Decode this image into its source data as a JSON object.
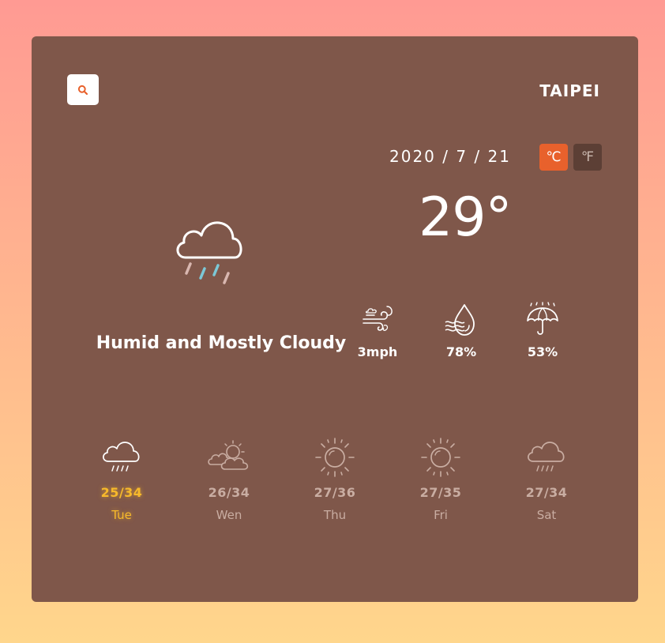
{
  "header": {
    "search_icon": "search-icon",
    "city": "TAIPEI"
  },
  "current": {
    "date": "2020 / 7 / 21",
    "temperature": "29°",
    "condition": "Humid and Mostly Cloudy",
    "icon": "cloud-rain-icon"
  },
  "units": {
    "celsius": "℃",
    "fahrenheit": "℉",
    "selected": "celsius"
  },
  "stats": [
    {
      "icon": "wind-icon",
      "value": "3mph"
    },
    {
      "icon": "humidity-icon",
      "value": "78%"
    },
    {
      "icon": "umbrella-icon",
      "value": "53%"
    }
  ],
  "forecast": [
    {
      "day": "Tue",
      "range": "25/34",
      "icon": "cloud-rain-icon",
      "active": true
    },
    {
      "day": "Wen",
      "range": "26/34",
      "icon": "partly-cloudy-icon",
      "active": false
    },
    {
      "day": "Thu",
      "range": "27/36",
      "icon": "sun-icon",
      "active": false
    },
    {
      "day": "Fri",
      "range": "27/35",
      "icon": "sun-icon",
      "active": false
    },
    {
      "day": "Sat",
      "range": "27/34",
      "icon": "cloud-rain-icon",
      "active": false
    }
  ],
  "colors": {
    "card": "#7f574a",
    "accent": "#e8612c",
    "active_day": "#f7b92b",
    "inactive_day": "#c9ada2",
    "rain_blue": "#7cc8d6",
    "rain_pink": "#d9b7b0"
  }
}
